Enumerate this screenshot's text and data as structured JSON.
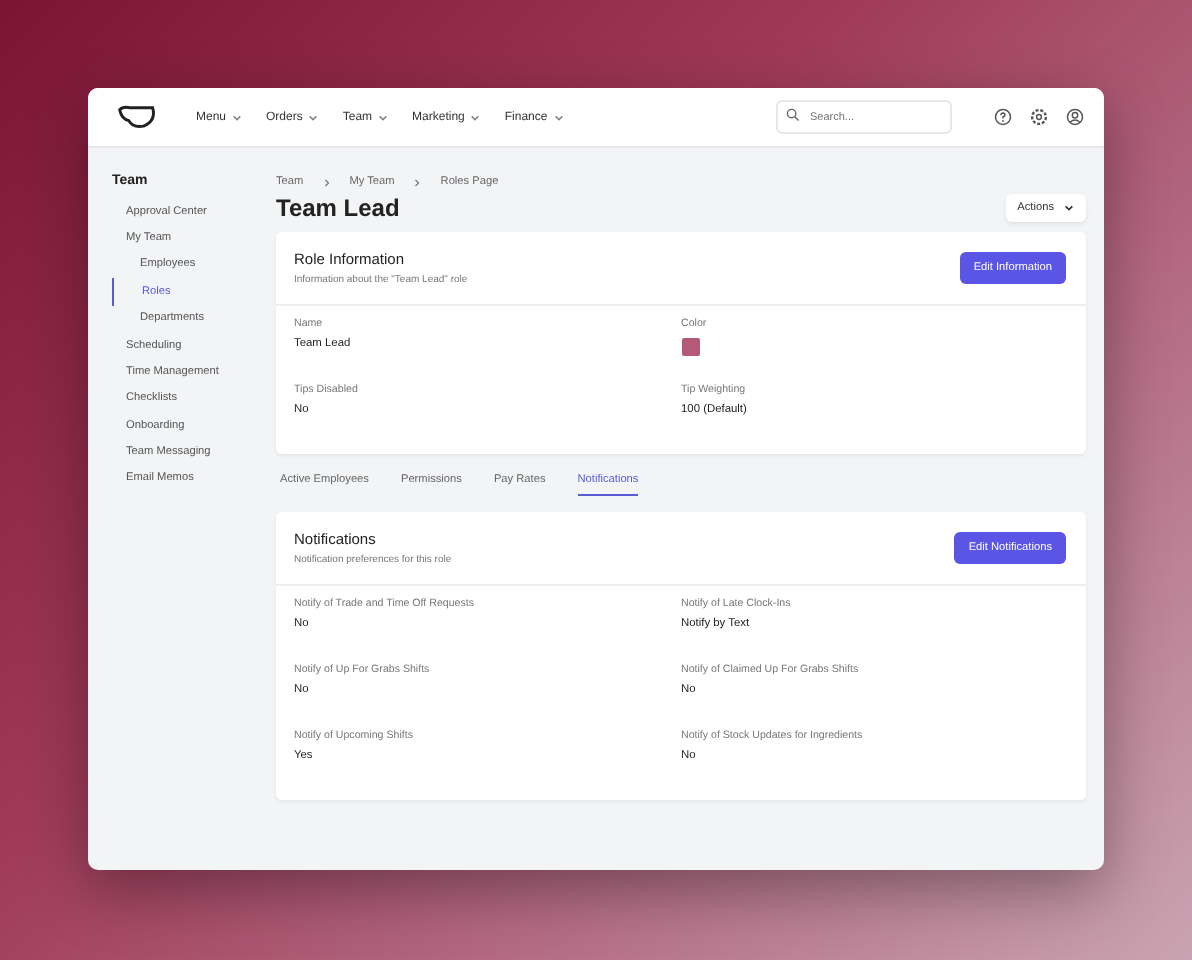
{
  "nav": {
    "menus": [
      {
        "label": "Menu"
      },
      {
        "label": "Orders"
      },
      {
        "label": "Team"
      },
      {
        "label": "Marketing"
      },
      {
        "label": "Finance"
      }
    ],
    "search": {
      "placeholder": "Search..."
    }
  },
  "sidebar": {
    "title": "Team",
    "items": [
      {
        "label": "Approval Center",
        "selected": false
      },
      {
        "label": "My Team",
        "selected": false,
        "children": [
          {
            "label": "Employees",
            "selected": false
          },
          {
            "label": "Roles",
            "selected": true
          },
          {
            "label": "Departments",
            "selected": false
          }
        ]
      },
      {
        "label": "Scheduling",
        "selected": false
      },
      {
        "label": "Time Management",
        "selected": false
      },
      {
        "label": "Checklists",
        "selected": false
      },
      {
        "label": "Onboarding",
        "selected": false
      },
      {
        "label": "Team Messaging",
        "selected": false
      },
      {
        "label": "Email Memos",
        "selected": false
      }
    ]
  },
  "breadcrumb": [
    "Team",
    "My Team",
    "Roles Page"
  ],
  "page_title": "Team Lead",
  "actions_button": "Actions",
  "role_card": {
    "title": "Role Information",
    "subtitle": "Information about the \"Team Lead\" role",
    "button": "Edit Information",
    "fields": [
      {
        "label": "Name",
        "kind": "text",
        "value": "Team Lead"
      },
      {
        "label": "Color",
        "kind": "color",
        "color": "#b5587a"
      },
      {
        "label": "Tips Disabled",
        "kind": "text",
        "value": "No"
      },
      {
        "label": "Tip Weighting",
        "kind": "text",
        "value": "100 (Default)"
      }
    ]
  },
  "tabs": [
    {
      "label": "Active Employees",
      "selected": false
    },
    {
      "label": "Permissions",
      "selected": false
    },
    {
      "label": "Pay Rates",
      "selected": false
    },
    {
      "label": "Notifications",
      "selected": true
    }
  ],
  "notifications_card": {
    "title": "Notifications",
    "subtitle": "Notification preferences for this role",
    "button": "Edit Notifications",
    "fields": [
      {
        "label": "Notify of Trade and Time Off Requests",
        "value": "No"
      },
      {
        "label": "Notify of Late Clock-Ins",
        "value": "Notify by Text"
      },
      {
        "label": "Notify of Up For Grabs Shifts",
        "value": "No"
      },
      {
        "label": "Notify of Claimed Up For Grabs Shifts",
        "value": "No"
      },
      {
        "label": "Notify of Upcoming Shifts",
        "value": "Yes"
      },
      {
        "label": "Notify of Stock Updates for Ingredients",
        "value": "No"
      }
    ]
  }
}
